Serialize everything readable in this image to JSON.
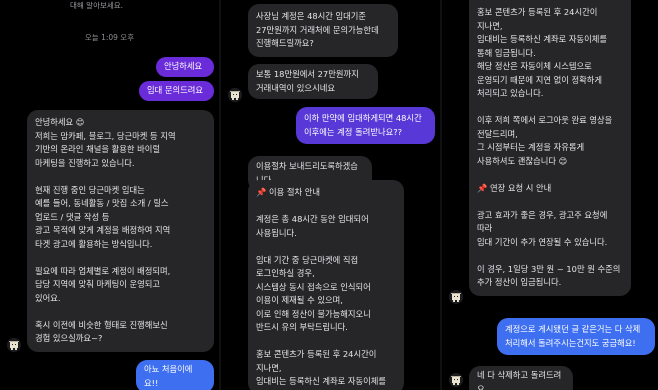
{
  "panel1": {
    "clipped_top": "대해 알아보세요.",
    "timestamp": "오늘 1:09 오후",
    "msg_hello": "안녕하세요",
    "msg_inquiry": "임대 문의드려요",
    "msg_intro": "안녕하세요 😊\n저희는 맘카페, 블로그, 당근마켓 등 지역\n기반의 온라인 채널을 활용한 바이럴\n마케팅을 진행하고 있습니다.\n\n현재 진행 중인 당근마켓 임대는\n예를 들어, 동네활동 / 맛집 소개 / 릴스\n업로드 / 댓글 작성 등\n광고 목적에 맞게 계정을 배정하여 지역\n타겟 광고에 활용하는 방식입니다.\n\n필요에 따라 업체별로 계정이 배정되며,\n담당 지역에 맞춰 마케팅이 운영되고\n있어요.\n\n혹시 이전에 비슷한 형태로 진행해보신\n경험 있으실까요~?",
    "msg_first_time": "아뇨 처음이에요!!"
  },
  "panel2": {
    "msg_criteria": "사장님 계정은 48시간 임대기준\n27만원까지 거래처에 문의가능한데\n진행해드릴까요?",
    "msg_range": "보통 18만원에서 27만원까지\n거래내역이 있으시네요",
    "msg_question": "이하 만약에 임대하게되면 48시간\n이후에는 계정 돌려받나요??",
    "msg_send_procedure": "이용절차 보내드리도록하겠습니다.",
    "msg_guide": "📌 이용 절차 안내\n\n계정은 총 48시간 동안 임대되어\n사용됩니다.\n\n임대 기간 중 당근마켓에 직접\n로그인하실 경우,\n시스템상 동시 접속으로 인식되어\n이용이 제재될 수 있으며,\n이로 인해 정산이 불가능해지오니\n반드시 유의 부탁드립니다.\n\n홍보 콘텐츠가 등록된 후 24시간이\n지나면,\n임대비는 등록하신 계좌로 자동이체를"
  },
  "panel3": {
    "msg_guide_cont": "홍보 콘텐츠가 등록된 후 24시간이\n지나면,\n임대비는 등록하신 계좌로 자동이체를\n통해 입금됩니다.\n해당 정산은 자동이체 시스템으로\n운영되기 때문에 지연 없이 정확하게\n처리되고 있습니다.\n\n이후 저희 쪽에서 로그아웃 완료 영상을\n전달드리며,\n그 시점부터는 계정을 자유롭게\n사용하셔도 괜찮습니다 😊\n\n📌 연장 요청 시 안내\n\n광고 효과가 좋은 경우, 광고주 요청에\n따라\n임대 기간이 추가 연장될 수 있습니다.\n\n이 경우, 1일당 3만 원 ~ 10만 원 수준의\n추가 정산이 입금됩니다.",
    "msg_withdrawn": "계정으로 게시됐던 글 같은거는 다 삭제\n처리해서 돌려주시는건지도 궁금해요!",
    "msg_delete": "네 다 삭제하고 돌려드려요"
  }
}
